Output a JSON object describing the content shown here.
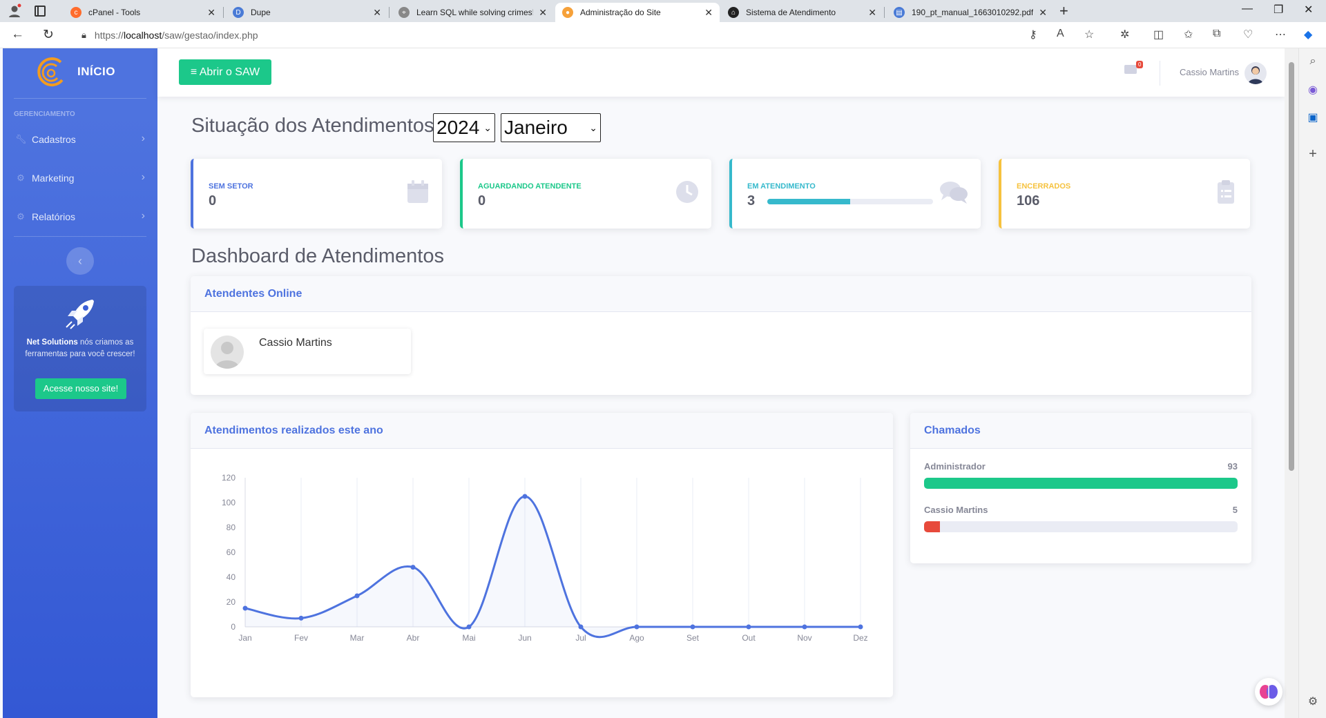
{
  "browser": {
    "tabs": [
      {
        "title": "cPanel - Tools",
        "color": "#ff6c2c",
        "glyph": "c"
      },
      {
        "title": "Dupe",
        "color": "#4a7bd6",
        "glyph": "D"
      },
      {
        "title": "Learn SQL while solving crimes! ·",
        "color": "#888888",
        "glyph": "⌖"
      },
      {
        "title": "Administração do Site",
        "color": "#f6a13a",
        "glyph": "●"
      },
      {
        "title": "Sistema de Atendimento",
        "color": "#222222",
        "glyph": "⌂"
      },
      {
        "title": "190_pt_manual_1663010292.pdf",
        "color": "#4a7bd6",
        "glyph": "▤"
      }
    ],
    "url_prefix": "https://",
    "url_host": "localhost",
    "url_path": "/saw/gestao/index.php"
  },
  "sidebar": {
    "brand": "INÍCIO",
    "heading": "GERENCIAMENTO",
    "items": [
      {
        "label": "Cadastros",
        "icon": "wrench-icon"
      },
      {
        "label": "Marketing",
        "icon": "gear-icon"
      },
      {
        "label": "Relatórios",
        "icon": "gear-icon"
      }
    ],
    "promo": {
      "brand": "Net Solutions",
      "text": " nós criamos as ferramentas para você crescer!",
      "button": "Acesse nosso site!"
    }
  },
  "topbar": {
    "button": "≡ Abrir o SAW",
    "badge": "0",
    "user": "Cassio Martins"
  },
  "main": {
    "title": "Situação dos Atendimentos",
    "year": "2024",
    "month": "Janeiro",
    "stats": [
      {
        "label": "SEM SETOR",
        "value": "0",
        "color": "#4e73df",
        "icon": "calendar-icon"
      },
      {
        "label": "AGUARDANDO ATENDENTE",
        "value": "0",
        "color": "#1cc88a",
        "icon": "clock-icon"
      },
      {
        "label": "EM ATENDIMENTO",
        "value": "3",
        "color": "#36b9cc",
        "icon": "comments-icon",
        "progress": 0.5
      },
      {
        "label": "ENCERRADOS",
        "value": "106",
        "color": "#f6c23e",
        "icon": "clipboard-icon"
      }
    ],
    "dashboard_title": "Dashboard de Atendimentos",
    "online": {
      "title": "Atendentes Online",
      "users": [
        "Cassio Martins"
      ]
    },
    "chart_title": "Atendimentos realizados este ano",
    "chamados": {
      "title": "Chamados",
      "rows": [
        {
          "name": "Administrador",
          "count": "93",
          "fraction": 1.0,
          "color": "#1cc88a"
        },
        {
          "name": "Cassio Martins",
          "count": "5",
          "fraction": 0.05,
          "color": "#e74a3b"
        }
      ]
    }
  },
  "chart_data": {
    "type": "line",
    "categories": [
      "Jan",
      "Fev",
      "Mar",
      "Abr",
      "Mai",
      "Jun",
      "Jul",
      "Ago",
      "Set",
      "Out",
      "Nov",
      "Dez"
    ],
    "values": [
      15,
      7,
      25,
      48,
      0,
      105,
      0,
      0,
      0,
      0,
      0,
      0
    ],
    "ylim": [
      0,
      120
    ],
    "yticks": [
      0,
      20,
      40,
      60,
      80,
      100,
      120
    ],
    "grid": true,
    "color": "#4e73df"
  }
}
